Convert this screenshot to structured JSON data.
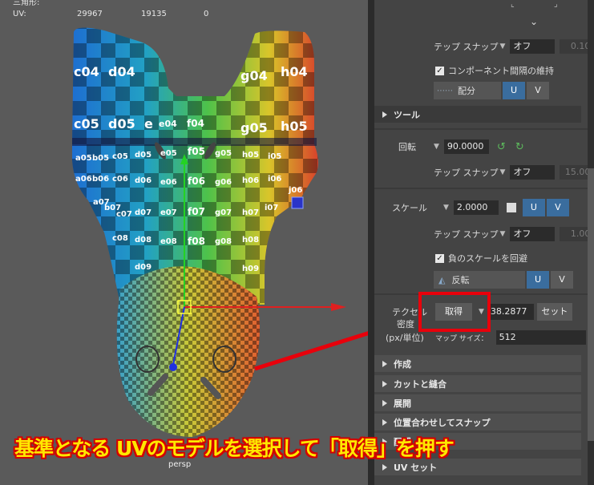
{
  "hud": {
    "title": "三角形:",
    "uv_label": "UV:",
    "uv_values": [
      "29967",
      "19135",
      "0"
    ]
  },
  "viewport": {
    "camera_label": "persp",
    "checker_labels": [
      "c04",
      "d04",
      "g04",
      "h04",
      "c05",
      "d05",
      "e",
      "e04",
      "f04",
      "g05",
      "h05",
      "a05",
      "b05",
      "c05",
      "d05",
      "e05",
      "f05",
      "g05",
      "h05",
      "i05",
      "a06",
      "b06",
      "c06",
      "d06",
      "e06",
      "f06",
      "g06",
      "h06",
      "i06",
      "j06",
      "a07",
      "b07",
      "c07",
      "d07",
      "e07",
      "f07",
      "g07",
      "h07",
      "i07",
      "c08",
      "d08",
      "e08",
      "f08",
      "g08",
      "h08",
      "d09",
      "h09"
    ]
  },
  "panel": {
    "tape_snap_label": "テップ スナップ",
    "off_label": "オフ",
    "snap_value_1": "0.10",
    "keep_spacing_label": "コンポーネント間隔の維持",
    "distribute_label": "配分",
    "u_label": "U",
    "v_label": "V",
    "tools_section": "ツール",
    "rotate_label": "回転",
    "rotate_value": "90.0000",
    "snap_value_2": "15.00",
    "scale_label": "スケール",
    "scale_value": "2.0000",
    "snap_value_3": "1.00",
    "avoid_negative_label": "負のスケールを回避",
    "flip_label": "反転",
    "texel_label_1": "テクセル",
    "texel_label_2": "密度",
    "texel_label_3": "(px/単位)",
    "get_button": "取得",
    "texel_value": "38.2877",
    "set_button": "セット",
    "map_size_label": "マップ サイズ：",
    "map_size_value": "512",
    "sections": [
      "作成",
      "カットと縫合",
      "展開",
      "位置合わせしてスナップ",
      "配置",
      "UV セット"
    ]
  },
  "annotation": {
    "caption": "基準となる UVのモデルを選択して「取得」を押す"
  },
  "colors": {
    "accent_blue": "#3a6d9e",
    "annotation_red": "#e8000b",
    "caption_yellow": "#ffe800"
  }
}
